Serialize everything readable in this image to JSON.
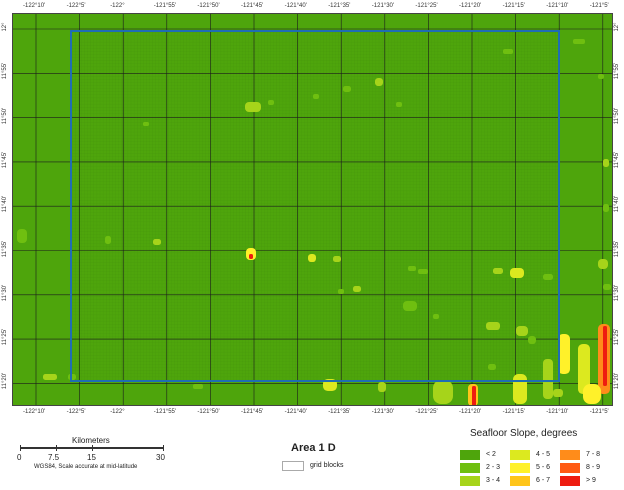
{
  "map": {
    "lon_labels": [
      "-122°10'",
      "-122°5'",
      "-122°",
      "-121°55'",
      "-121°50'",
      "-121°45'",
      "-121°40'",
      "-121°35'",
      "-121°30'",
      "-121°25'",
      "-121°20'",
      "-121°15'",
      "-121°10'",
      "-121°5'"
    ],
    "lat_labels": [
      "12°",
      "11°55'",
      "11°50'",
      "11°45'",
      "11°40'",
      "11°35'",
      "11°30'",
      "11°25'",
      "11°20'"
    ],
    "colors": {
      "background": "#4ea50c",
      "grid": "#3c6e10",
      "graticule": "#1b1b1b",
      "area_outline": "#1f6db5"
    }
  },
  "scale": {
    "title": "Kilometers",
    "ticks": [
      "0",
      "7.5",
      "15",
      "30"
    ],
    "note": "WGS84, Scale accurate at mid-latitude"
  },
  "area_title": "Area 1 D",
  "grid_key": {
    "label": "grid blocks"
  },
  "legend": {
    "title": "Seafloor Slope, degrees",
    "items": [
      {
        "label": "< 2",
        "color": "#4ea50c"
      },
      {
        "label": "2 - 3",
        "color": "#6fbf10"
      },
      {
        "label": "3 - 4",
        "color": "#a6d41a"
      },
      {
        "label": "4 - 5",
        "color": "#dce91f"
      },
      {
        "label": "5 - 6",
        "color": "#fff12a"
      },
      {
        "label": "6 - 7",
        "color": "#ffc51a"
      },
      {
        "label": "7 - 8",
        "color": "#ff8c1a"
      },
      {
        "label": "8 - 9",
        "color": "#ff5a14"
      },
      {
        "label": "> 9",
        "color": "#ee1c10"
      }
    ]
  }
}
